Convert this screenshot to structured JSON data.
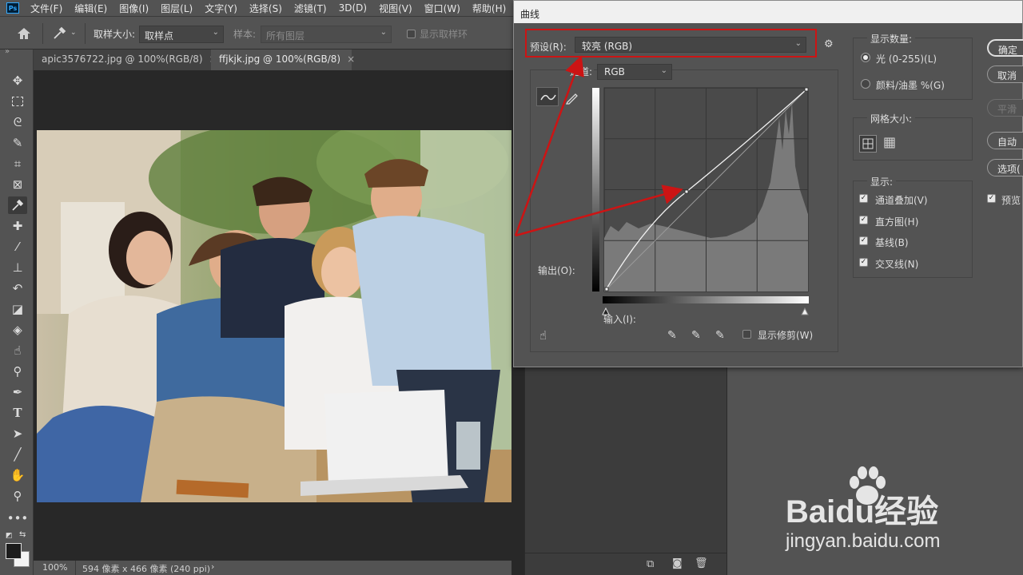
{
  "menubar": {
    "logo": "Ps",
    "items": [
      "文件(F)",
      "编辑(E)",
      "图像(I)",
      "图层(L)",
      "文字(Y)",
      "选择(S)",
      "滤镜(T)",
      "3D(D)",
      "视图(V)",
      "窗口(W)",
      "帮助(H)"
    ]
  },
  "options": {
    "sample_size_label": "取样大小:",
    "sample_size_value": "取样点",
    "sample_label": "样本:",
    "sample_value": "所有图层",
    "show_ring_label": "显示取样环"
  },
  "tabs": [
    {
      "label": "apic3576722.jpg @ 100%(RGB/8)",
      "close": "×"
    },
    {
      "label": "ffjkjk.jpg @ 100%(RGB/8)",
      "close": "×"
    }
  ],
  "status": {
    "zoom": "100%",
    "doc_info": "594 像素 x 466 像素 (240 ppi)",
    "arrow": "›"
  },
  "curves_dialog": {
    "title": "曲线",
    "preset_label": "预设(R):",
    "preset_value": "较亮 (RGB)",
    "channel_label": "通道:",
    "channel_value": "RGB",
    "output_label": "输出(O):",
    "input_label": "输入(I):",
    "show_clipping_label": "显示修剪(W)",
    "show_amount_title": "显示数量:",
    "light_label": "光 (0-255)(L)",
    "pigment_label": "颜料/油墨 %(G)",
    "grid_size_title": "网格大小:",
    "display_title": "显示:",
    "display_options": [
      "通道叠加(V)",
      "直方图(H)",
      "基线(B)",
      "交叉线(N)"
    ],
    "buttons": {
      "ok": "确定",
      "cancel": "取消",
      "smooth": "平滑",
      "auto": "自动",
      "options": "选项(",
      "preview": "预览"
    },
    "curve_point": {
      "input": 82,
      "output": 118
    }
  },
  "colors": {
    "annotation_red": "#cc1414",
    "ui_dark": "#535353",
    "canvas_bg": "#282828"
  },
  "watermark": {
    "brand": "Baidu经验",
    "url": "jingyan.baidu.com"
  }
}
